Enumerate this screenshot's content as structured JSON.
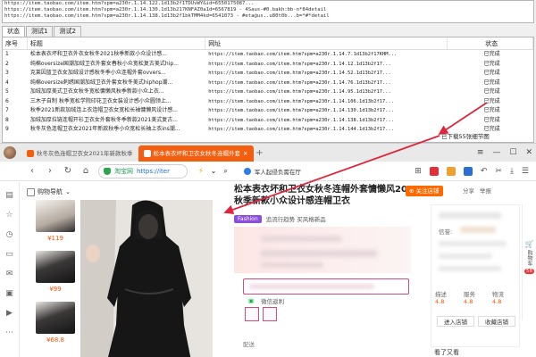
{
  "app": {
    "log_lines": [
      "https://item.taobao.com/item.htm?spm=a230r.1.14.122.1d13b2f1TDUvWY&id=6550175087...",
      "https://item.taobao.com/item.htm?spm=a230r.1.14.130.1d13b217KNFAZ0a1d=6567819 - 4Saus-#0.bakh:bb-n*84detail",
      "https://item.taobao.com/item.htm?spm=a230r.1.14.138.1d13b2f1bkTMM4kd=6541073 - #eta@us..u80t0b...b=*#*detail"
    ],
    "tabs": [
      "状态",
      "测试1",
      "测试2"
    ],
    "active_tab": 0,
    "columns": [
      "序号",
      "标题",
      "网址",
      "状态"
    ],
    "rows": [
      [
        "1",
        "松本表衣坏和卫衣外衣女秋冬2021秋季新款小众设计感...",
        "https://item.taobao.com/item.htm?spm=a230r.1.14.7.1d13b2f17KHM...",
        "已完成"
      ],
      [
        "2",
        "纯棉oversize国潮加绒卫衣外套女春秋小众宽松复古美式hip...",
        "https://item.taobao.com/item.htm?spm=a230r.1.14.12.1d13b2f17...",
        "已完成"
      ],
      [
        "3",
        "克莱因蓝卫衣女加绒设计感秋冬季小众连帽外套ovvers...",
        "https://item.taobao.com/item.htm?spm=a230r.1.14.52.1d13b2f17...",
        "已完成"
      ],
      [
        "4",
        "纯棉oversize刺绣国潮加绒卫衣外套女秋冬美式hiphop潮...",
        "https://item.taobao.com/item.htm?spm=a230r.1.14.76.1d13b2f17...",
        "已完成"
      ],
      [
        "5",
        "加绒加厚美式卫衣女秋冬宽松慵懒风秋季新款小众上衣...",
        "https://item.taobao.com/item.htm?spm=a230r.1.14.95.1d13b2f17...",
        "已完成"
      ],
      [
        "6",
        "三木子自制 秋季宽松学院印花卫衣女装设计感小众圆领上...",
        "https://item.taobao.com/item.htm?spm=a230r.1.14.106.1d13b2f17...",
        "已完成"
      ],
      [
        "7",
        "秋季2021新款加绒连上衣连帽卫衣女宽松长袖慵懒风设计感...",
        "https://item.taobao.com/item.htm?spm=a230r.1.14.130.1d13b2f17...",
        "已完成"
      ],
      [
        "8",
        "加绒加厚拉链连帽开衫卫衣女外套秋冬季新款2021美式复古...",
        "https://item.taobao.com/item.htm?spm=a230r.1.14.138.1d13b2f17...",
        "已完成"
      ],
      [
        "9",
        "秋冬灰色连帽卫衣女2021年新款秋季小众宽松长袖上衣ins潮...",
        "https://item.taobao.com/item.htm?spm=a230r.1.14.144.1d13b2f17...",
        "已完成"
      ]
    ],
    "download_label": "已下载55张细节图"
  },
  "browser": {
    "tabs": [
      {
        "label": "秋冬灰色连帽卫衣女2021年新款秋季",
        "active": false
      },
      {
        "label": "松本表衣坏和卫衣女秋冬连帽外套",
        "active": true
      }
    ],
    "window_controls": [
      "≡",
      "—",
      "☐",
      "✕"
    ],
    "address": {
      "brand": "淘宝网",
      "url": "https://iter"
    },
    "news": "军人起侵负需在厅",
    "page": {
      "guide_label": "购物导航",
      "thumb_prices": [
        "¥119",
        "¥99",
        "¥68.8"
      ],
      "product_title": "松本表衣坏和卫衣女秋冬连帽外套慵懒风2021秋季新款小众设计感连帽卫衣",
      "fashion_tag": "Fashion",
      "fashion_text": "追流行趋势 买风格新品",
      "wechat_label": "微信返利",
      "delivery_label": "配送",
      "follow_label": "⊕ 关注店铺",
      "share_label": "分享",
      "report_label": "举报",
      "shop": {
        "credit_label": "信誉:",
        "metrics": [
          {
            "label": "描述",
            "value": "4.8"
          },
          {
            "label": "服务",
            "value": "4.8"
          },
          {
            "label": "物流",
            "value": "4.8"
          }
        ],
        "enter_label": "进入店铺",
        "fav_label": "收藏店铺"
      },
      "see_also_label": "看了又看",
      "cart": {
        "label": "购物车",
        "count": "58"
      }
    }
  },
  "colors": {
    "taobao_orange": "#f45e0f",
    "price_orange": "#ff5000",
    "annotation_red": "#e0243a",
    "status_done": "#222222"
  }
}
